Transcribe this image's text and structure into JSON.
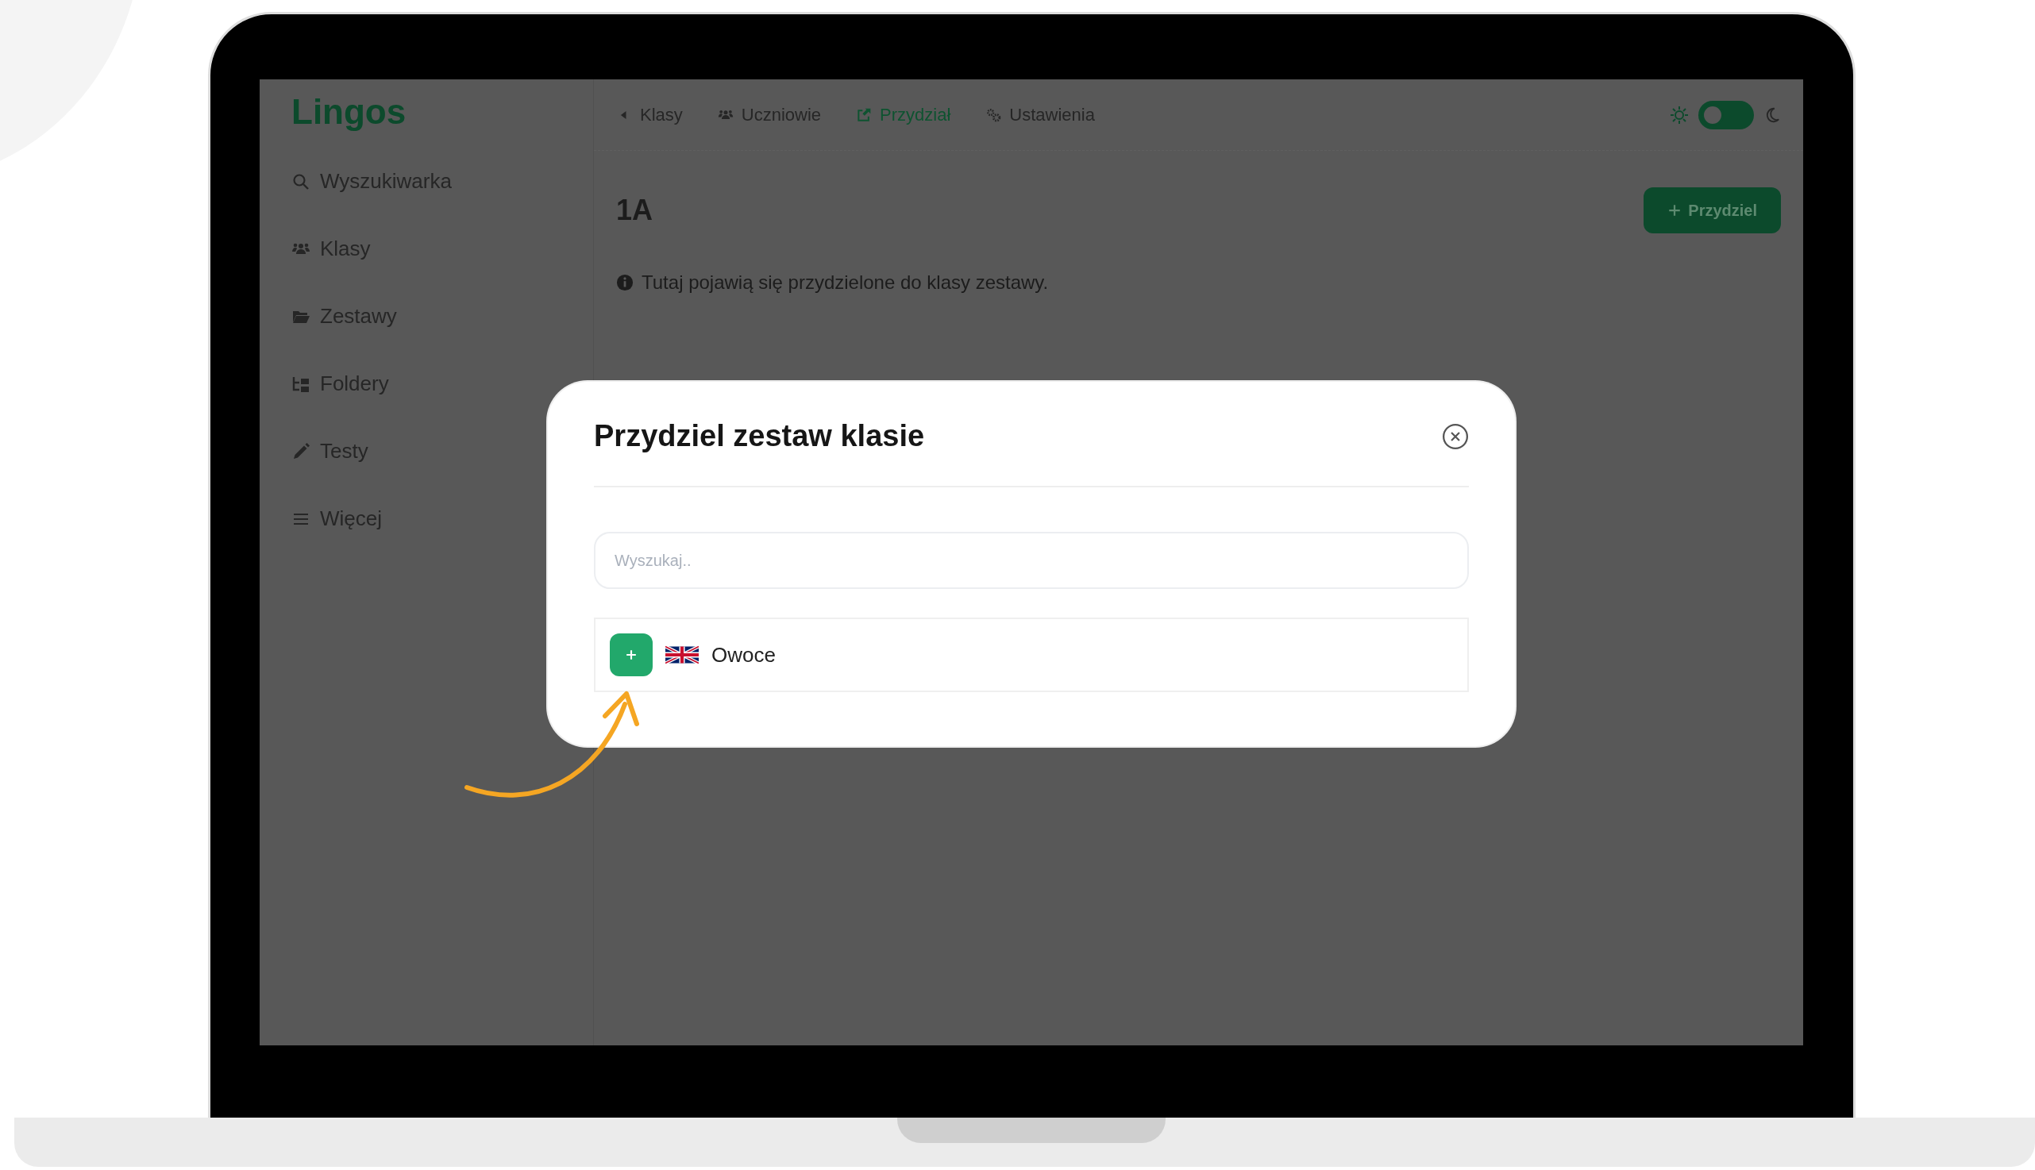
{
  "sidebar": {
    "logo": "Lingos",
    "items": [
      {
        "label": "Wyszukiwarka"
      },
      {
        "label": "Klasy"
      },
      {
        "label": "Zestawy"
      },
      {
        "label": "Foldery"
      },
      {
        "label": "Testy"
      },
      {
        "label": "Więcej"
      }
    ]
  },
  "topnav": {
    "items": [
      {
        "label": "Klasy",
        "selected": false
      },
      {
        "label": "Uczniowie",
        "selected": false
      },
      {
        "label": "Przydział",
        "selected": true
      },
      {
        "label": "Ustawienia",
        "selected": false
      }
    ],
    "theme_toggle": {
      "dark": false
    }
  },
  "page": {
    "title": "1A",
    "assign_button": "Przydziel",
    "info": "Tutaj pojawią się przydzielone do klasy zestawy."
  },
  "modal": {
    "title": "Przydziel zestaw klasie",
    "search": {
      "placeholder": "Wyszukaj.."
    },
    "sets": [
      {
        "name": "Owoce"
      }
    ]
  }
}
